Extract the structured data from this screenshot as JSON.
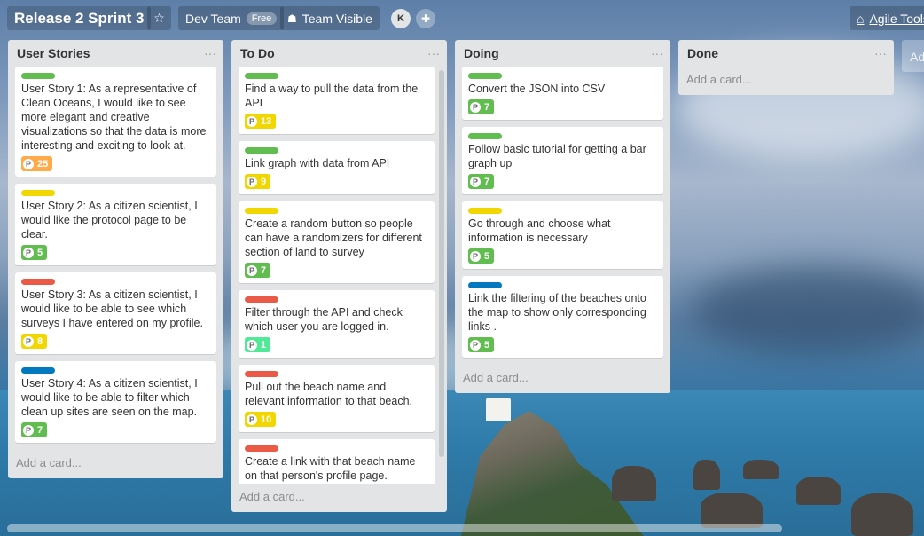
{
  "board": {
    "title": "Release 2 Sprint 3",
    "team": "Dev Team",
    "team_badge": "Free",
    "visibility": "Team Visible",
    "member_initial": "K",
    "agile_tools": "Agile Tools",
    "add_list": "Ad",
    "colors": {
      "green": "#61bd4f",
      "yellow": "#f2d600",
      "red": "#eb5a46",
      "blue": "#0079bf",
      "orange": "#ffab4a",
      "lime": "#51e898"
    }
  },
  "lists": [
    {
      "title": "User Stories",
      "add_card": "Add a card...",
      "cards": [
        {
          "label": "green",
          "text": "User Story 1: As a representative of Clean Oceans, I would like to see more elegant and creative visualizations so that the data is more interesting and exciting to look at.",
          "points": "25",
          "badge": "orange"
        },
        {
          "label": "yellow",
          "text": "User Story 2: As a citizen scientist, I would like the protocol page to be clear.",
          "points": "5",
          "badge": "green"
        },
        {
          "label": "red",
          "text": "User Story 3: As a citizen scientist, I would like to be able to see which surveys I have entered on my profile.",
          "points": "8",
          "badge": "yellow"
        },
        {
          "label": "blue",
          "text": "User Story 4: As a citizen scientist, I would like to be able to filter which clean up sites are seen on the map.",
          "points": "7",
          "badge": "green"
        }
      ]
    },
    {
      "title": "To Do",
      "add_card": "Add a card...",
      "cards": [
        {
          "label": "green",
          "text": "Find a way to pull the data from the API",
          "points": "13",
          "badge": "yellow"
        },
        {
          "label": "green",
          "text": "Link graph with data from API",
          "points": "9",
          "badge": "yellow"
        },
        {
          "label": "yellow",
          "text": "Create a random button so people can have a randomizers for different section of land to survey",
          "points": "7",
          "badge": "green"
        },
        {
          "label": "red",
          "text": "Filter through the API and check which user you are logged in.",
          "points": "1",
          "badge": "lime"
        },
        {
          "label": "red",
          "text": "Pull out the beach name and relevant information to that beach.",
          "points": "10",
          "badge": "yellow"
        },
        {
          "label": "red",
          "text": "Create a link with that beach name on that person's profile page.",
          "points": "",
          "badge": ""
        }
      ]
    },
    {
      "title": "Doing",
      "add_card": "Add a card...",
      "cards": [
        {
          "label": "green",
          "text": "Convert the JSON into CSV",
          "points": "7",
          "badge": "green"
        },
        {
          "label": "green",
          "text": "Follow basic tutorial for getting a bar graph up",
          "points": "7",
          "badge": "green"
        },
        {
          "label": "yellow",
          "text": "Go through and choose what information is necessary",
          "points": "5",
          "badge": "green"
        },
        {
          "label": "blue",
          "text": "Link the filtering of the beaches onto the map to show only corresponding links .",
          "points": "5",
          "badge": "green"
        }
      ]
    },
    {
      "title": "Done",
      "add_card": "Add a card...",
      "cards": []
    }
  ]
}
